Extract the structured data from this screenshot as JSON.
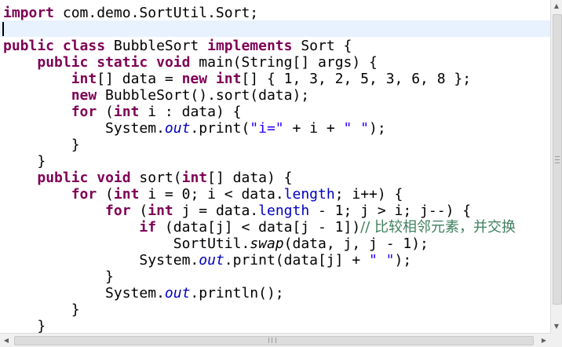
{
  "code": {
    "l1": {
      "kw1": "import",
      "t1": " com.demo.SortUtil.Sort;"
    },
    "l2": {
      "t1": ""
    },
    "l3": {
      "kw1": "public",
      "kw2": "class",
      "t1": " BubbleSort ",
      "kw3": "implements",
      "t2": " Sort {"
    },
    "l4": {
      "indent": "    ",
      "kw1": "public",
      "kw2": "static",
      "kw3": "void",
      "t1": " main(String[] args) {"
    },
    "l5": {
      "indent": "        ",
      "kw1": "int",
      "t1": "[] data = ",
      "kw2": "new",
      "kw3": "int",
      "t2": "[] { 1, 3, 2, 5, 3, 6, 8 };"
    },
    "l6": {
      "indent": "        ",
      "kw1": "new",
      "t1": " BubbleSort().sort(data);"
    },
    "l7": {
      "indent": "        ",
      "kw1": "for",
      "t1": " (",
      "kw2": "int",
      "t2": " i : data) {"
    },
    "l8": {
      "indent": "            ",
      "t1": "System.",
      "fld": "out",
      "t2": ".print(",
      "str1": "\"i=\"",
      "t3": " + i + ",
      "str2": "\" \"",
      "t4": ");"
    },
    "l9": {
      "indent": "        ",
      "t1": "}"
    },
    "l10": {
      "indent": "    ",
      "t1": "}"
    },
    "l11": {
      "indent": "    ",
      "kw1": "public",
      "kw2": "void",
      "t1": " sort(",
      "kw3": "int",
      "t2": "[] data) {"
    },
    "l12": {
      "indent": "        ",
      "kw1": "for",
      "t1": " (",
      "kw2": "int",
      "t2": " i = 0; i < data.",
      "mfld": "length",
      "t3": "; i++) {"
    },
    "l13": {
      "indent": "            ",
      "kw1": "for",
      "t1": " (",
      "kw2": "int",
      "t2": " j = data.",
      "mfld": "length",
      "t3": " - 1; j > i; j--) {"
    },
    "l14": {
      "indent": "                ",
      "kw1": "if",
      "t1": " (data[j] < data[j - 1])",
      "cmt": "// 比较相邻元素，并交换"
    },
    "l15": {
      "indent": "                    ",
      "t1": "SortUtil.",
      "st": "swap",
      "t2": "(data, j, j - 1);"
    },
    "l16": {
      "indent": "                ",
      "t1": "System.",
      "fld": "out",
      "t2": ".print(data[j] + ",
      "str1": "\" \"",
      "t3": ");"
    },
    "l17": {
      "indent": "            ",
      "t1": "}"
    },
    "l18": {
      "indent": "            ",
      "t1": "System.",
      "fld": "out",
      "t2": ".println();"
    },
    "l19": {
      "indent": "        ",
      "t1": "}"
    },
    "l20": {
      "indent": "    ",
      "t1": "}"
    }
  },
  "scrollbar": {
    "up_glyph": "▲",
    "down_glyph": "▼",
    "left_glyph": "◀",
    "right_glyph": "▶"
  },
  "colors": {
    "keyword": "#7f0055",
    "string": "#2a00ff",
    "field": "#0000c0",
    "comment": "#3f7f5f",
    "current_line": "#e8f2fe"
  }
}
